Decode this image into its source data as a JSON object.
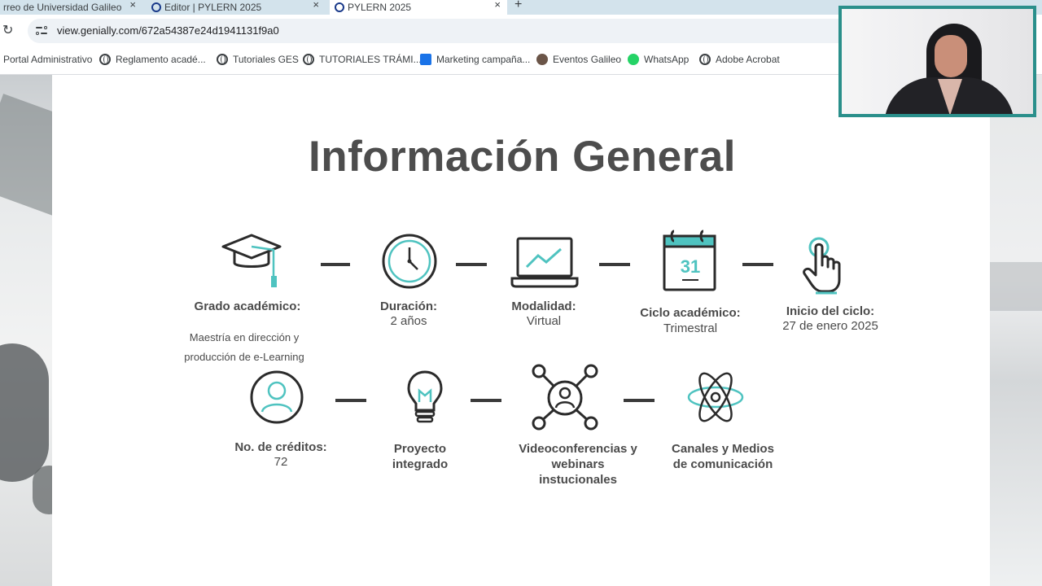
{
  "browser": {
    "tabs": [
      {
        "title": "rreo de Universidad Galileo",
        "close": "×"
      },
      {
        "title": "Editor | PYLERN 2025",
        "close": "×"
      },
      {
        "title": "PYLERN 2025",
        "close": "×"
      }
    ],
    "new_tab": "+",
    "reload": "↻",
    "url": "view.genially.com/672a54387e24d1941131f9a0"
  },
  "bookmarks": [
    {
      "label": "Portal Administrativo",
      "icon": "none"
    },
    {
      "label": "Reglamento acadé...",
      "icon": "globe-icon"
    },
    {
      "label": "Tutoriales GES",
      "icon": "globe-icon"
    },
    {
      "label": "TUTORIALES TRÁMI...",
      "icon": "globe-icon"
    },
    {
      "label": "Marketing campaña...",
      "icon": "marketing-icon"
    },
    {
      "label": "Eventos Galileo",
      "icon": "photo-icon"
    },
    {
      "label": "WhatsApp",
      "icon": "whatsapp-icon"
    },
    {
      "label": "Adobe Acrobat",
      "icon": "globe-icon"
    }
  ],
  "slide": {
    "title": "Información General",
    "accent_color": "#4fc3c0",
    "items": [
      {
        "label": "Grado académico:",
        "value": "",
        "desc": [
          "Maestría en dirección y",
          "producción de e-Learning"
        ],
        "icon": "graduation-cap-icon"
      },
      {
        "label": "Duración:",
        "value": "2 años",
        "icon": "clock-icon"
      },
      {
        "label": "Modalidad:",
        "value": "Virtual",
        "icon": "laptop-chart-icon"
      },
      {
        "label": "Ciclo académico:",
        "value": "Trimestral",
        "icon": "calendar-icon",
        "icon_text": "31"
      },
      {
        "label": "Inicio del ciclo:",
        "value": "27 de enero 2025",
        "icon": "pointer-hand-icon"
      },
      {
        "label": "No. de créditos:",
        "value": "72",
        "icon": "user-circle-icon"
      },
      {
        "label_lines": [
          "Proyecto",
          "integrado"
        ],
        "icon": "lightbulb-icon"
      },
      {
        "label_lines": [
          "Videoconferencias y",
          "webinars",
          "instucionales"
        ],
        "icon": "network-user-icon"
      },
      {
        "label_lines": [
          "Canales y Medios",
          "de comunicación"
        ],
        "icon": "atom-icon"
      }
    ]
  }
}
